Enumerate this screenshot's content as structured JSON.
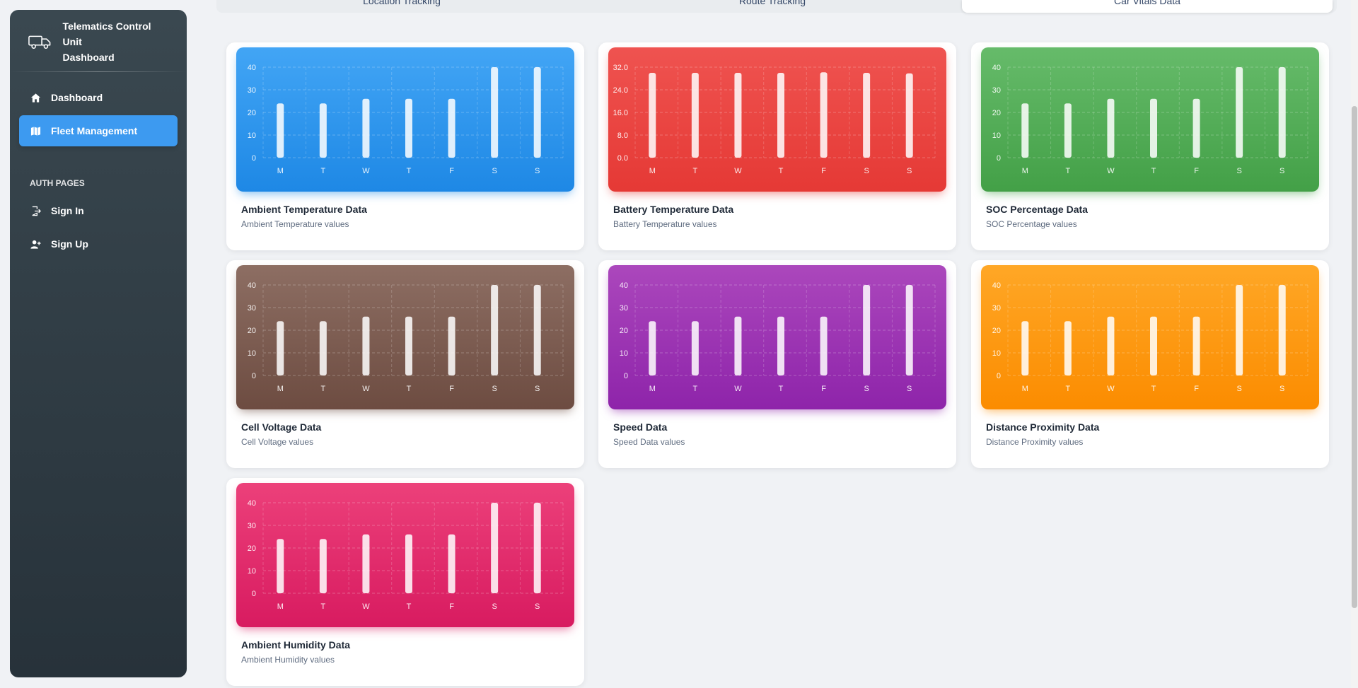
{
  "sidebar": {
    "brand_title_line1": "Telematics Control Unit",
    "brand_title_line2": "Dashboard",
    "brand_icon": "truck-icon",
    "items": [
      {
        "label": "Dashboard",
        "icon": "home-icon"
      },
      {
        "label": "Fleet Management",
        "icon": "map-icon"
      }
    ],
    "section_label": "AUTH PAGES",
    "auth_items": [
      {
        "label": "Sign In",
        "icon": "sign-in-icon"
      },
      {
        "label": "Sign Up",
        "icon": "add-user-icon"
      }
    ]
  },
  "tabs": [
    {
      "label": "Location Tracking"
    },
    {
      "label": "Route Tracking"
    },
    {
      "label": "Car Vitals Data"
    }
  ],
  "cards": [
    {
      "title": "Ambient Temperature Data",
      "subtitle": "Ambient Temperature values"
    },
    {
      "title": "Battery Temperature Data",
      "subtitle": "Battery Temperature values"
    },
    {
      "title": "SOC Percentage Data",
      "subtitle": "SOC Percentage values"
    },
    {
      "title": "Cell Voltage Data",
      "subtitle": "Cell Voltage values"
    },
    {
      "title": "Speed Data",
      "subtitle": "Speed Data values"
    },
    {
      "title": "Distance Proximity Data",
      "subtitle": "Distance Proximity values"
    },
    {
      "title": "Ambient Humidity Data",
      "subtitle": "Ambient Humidity values"
    }
  ],
  "chart_data": [
    {
      "type": "bar",
      "categories": [
        "M",
        "T",
        "W",
        "T",
        "F",
        "S",
        "S"
      ],
      "values": [
        24,
        24,
        26,
        26,
        26,
        40,
        40
      ],
      "ylim": [
        0,
        40
      ],
      "yticks": [
        "0",
        "10",
        "20",
        "30",
        "40"
      ],
      "grid": true,
      "color_top": "#42a5f5",
      "color_bottom": "#1e88e5"
    },
    {
      "type": "bar",
      "categories": [
        "M",
        "T",
        "W",
        "T",
        "F",
        "S",
        "S"
      ],
      "values": [
        30,
        30,
        30,
        30,
        30.2,
        30,
        29.8
      ],
      "ylim": [
        0,
        32
      ],
      "yticks": [
        "0.0",
        "8.0",
        "16.0",
        "24.0",
        "32.0"
      ],
      "grid": true,
      "color_top": "#ef5350",
      "color_bottom": "#e53935"
    },
    {
      "type": "bar",
      "categories": [
        "M",
        "T",
        "W",
        "T",
        "F",
        "S",
        "S"
      ],
      "values": [
        24,
        24,
        26,
        26,
        26,
        40,
        40
      ],
      "ylim": [
        0,
        40
      ],
      "yticks": [
        "0",
        "10",
        "20",
        "30",
        "40"
      ],
      "grid": true,
      "color_top": "#66bb6a",
      "color_bottom": "#43a047"
    },
    {
      "type": "bar",
      "categories": [
        "M",
        "T",
        "W",
        "T",
        "F",
        "S",
        "S"
      ],
      "values": [
        24,
        24,
        26,
        26,
        26,
        40,
        40
      ],
      "ylim": [
        0,
        40
      ],
      "yticks": [
        "0",
        "10",
        "20",
        "30",
        "40"
      ],
      "grid": true,
      "color_top": "#8d6e63",
      "color_bottom": "#6d4c41"
    },
    {
      "type": "bar",
      "categories": [
        "M",
        "T",
        "W",
        "T",
        "F",
        "S",
        "S"
      ],
      "values": [
        24,
        24,
        26,
        26,
        26,
        40,
        40
      ],
      "ylim": [
        0,
        40
      ],
      "yticks": [
        "0",
        "10",
        "20",
        "30",
        "40"
      ],
      "grid": true,
      "color_top": "#ab47bc",
      "color_bottom": "#8e24aa"
    },
    {
      "type": "bar",
      "categories": [
        "M",
        "T",
        "W",
        "T",
        "F",
        "S",
        "S"
      ],
      "values": [
        24,
        24,
        26,
        26,
        26,
        40,
        40
      ],
      "ylim": [
        0,
        40
      ],
      "yticks": [
        "0",
        "10",
        "20",
        "30",
        "40"
      ],
      "grid": true,
      "color_top": "#ffa726",
      "color_bottom": "#fb8c00"
    },
    {
      "type": "bar",
      "categories": [
        "M",
        "T",
        "W",
        "T",
        "F",
        "S",
        "S"
      ],
      "values": [
        24,
        24,
        26,
        26,
        26,
        40,
        40
      ],
      "ylim": [
        0,
        40
      ],
      "yticks": [
        "0",
        "10",
        "20",
        "30",
        "40"
      ],
      "grid": true,
      "color_top": "#ec407a",
      "color_bottom": "#d81b60"
    }
  ]
}
